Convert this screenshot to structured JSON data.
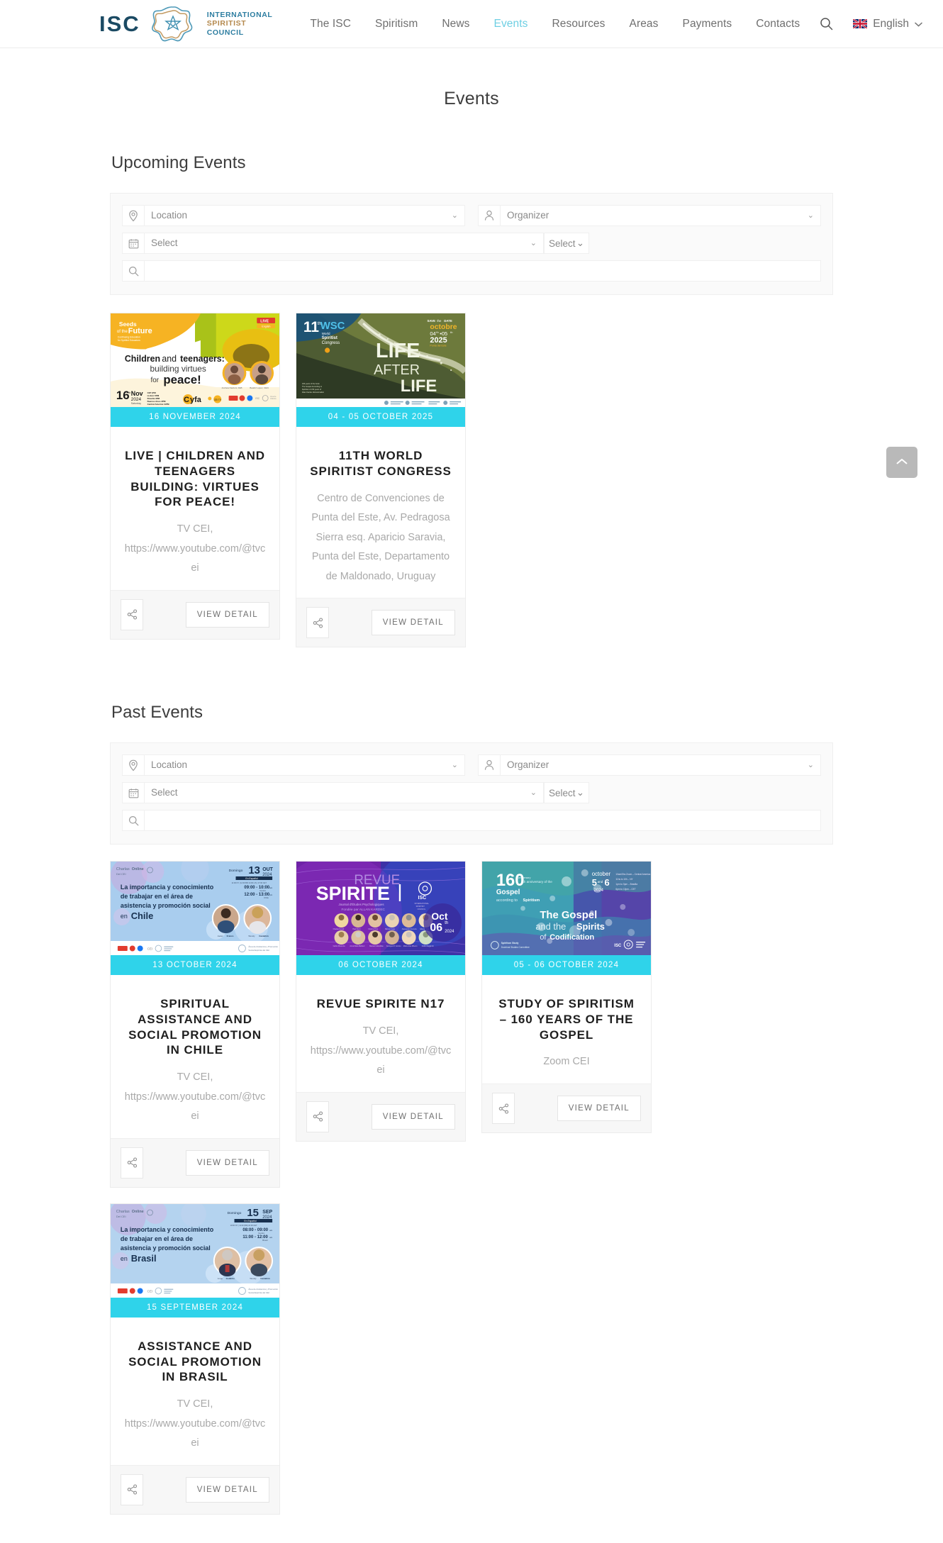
{
  "header": {
    "logo_text": "ISC",
    "logo_lines": [
      "INTERNATIONAL",
      "SPIRITIST",
      "COUNCIL"
    ],
    "nav": [
      {
        "label": "The ISC",
        "active": false
      },
      {
        "label": "Spiritism",
        "active": false
      },
      {
        "label": "News",
        "active": false
      },
      {
        "label": "Events",
        "active": true
      },
      {
        "label": "Resources",
        "active": false
      },
      {
        "label": "Areas",
        "active": false
      },
      {
        "label": "Payments",
        "active": false
      },
      {
        "label": "Contacts",
        "active": false
      }
    ],
    "search_icon": "search-icon",
    "language": "English",
    "language_flag": "uk-flag-icon",
    "language_caret": "chevron-down-icon"
  },
  "page": {
    "title": "Events",
    "accent_color": "#2fd3ea",
    "scroll_top_icon": "chevron-up-icon"
  },
  "sections": [
    {
      "heading": "Upcoming Events",
      "filters": {
        "location_icon": "map-pin-icon",
        "location_placeholder": "Location",
        "organizer_icon": "person-icon",
        "organizer_placeholder": "Organizer",
        "date_icon": "calendar-icon",
        "date_placeholder": "Select",
        "date_small_placeholder": "Select",
        "search_icon": "search-icon",
        "search_value": "",
        "search_placeholder": ""
      },
      "events": [
        {
          "date": "16 NOVEMBER 2024",
          "title": "LIVE | CHILDREN AND TEENAGERS BUILDING: VIRTUES FOR PEACE!",
          "meta": "TV CEI, https://www.youtube.com/@tvcei",
          "share_icon": "share-icon",
          "view_label": "VIEW DETAIL",
          "poster": "seeds-of-the-future-children-teenagers-peace"
        },
        {
          "date": "04 - 05 OCTOBER 2025",
          "title": "11TH WORLD SPIRITIST CONGRESS",
          "meta": "Centro de Convenciones de Punta del Este, Av. Pedragosa Sierra esq. Aparicio Saravia, Punta del Este, Departamento de Maldonado, Uruguay",
          "share_icon": "share-icon",
          "view_label": "VIEW DETAIL",
          "poster": "life-after-life-world-congress"
        }
      ]
    },
    {
      "heading": "Past Events",
      "filters": {
        "location_icon": "map-pin-icon",
        "location_placeholder": "Location",
        "organizer_icon": "person-icon",
        "organizer_placeholder": "Organizer",
        "date_icon": "calendar-icon",
        "date_placeholder": "Select",
        "date_small_placeholder": "Select",
        "search_icon": "search-icon",
        "search_value": "",
        "search_placeholder": ""
      },
      "events": [
        {
          "date": "13 OCTOBER 2024",
          "title": "SPIRITUAL ASSISTANCE AND SOCIAL PROMOTION IN CHILE",
          "meta": "TV CEI, https://www.youtube.com/@tvcei",
          "share_icon": "share-icon",
          "view_label": "VIEW DETAIL",
          "poster": "asistencia-promocion-social-chile"
        },
        {
          "date": "06 OCTOBER 2024",
          "title": "REVUE SPIRITE N17",
          "meta": "TV CEI, https://www.youtube.com/@tvcei",
          "share_icon": "share-icon",
          "view_label": "VIEW DETAIL",
          "poster": "revue-spirite"
        },
        {
          "date": "05 - 06 OCTOBER 2024",
          "title": "STUDY OF SPIRITISM – 160 YEARS OF THE GOSPEL",
          "meta": "Zoom CEI",
          "share_icon": "share-icon",
          "view_label": "VIEW DETAIL",
          "poster": "gospel-160-years"
        },
        {
          "date": "15 SEPTEMBER 2024",
          "title": "ASSISTANCE AND SOCIAL PROMOTION IN BRASIL",
          "meta": "TV CEI, https://www.youtube.com/@tvcei",
          "share_icon": "share-icon",
          "view_label": "VIEW DETAIL",
          "poster": "asistencia-promocion-social-brasil"
        }
      ]
    }
  ]
}
